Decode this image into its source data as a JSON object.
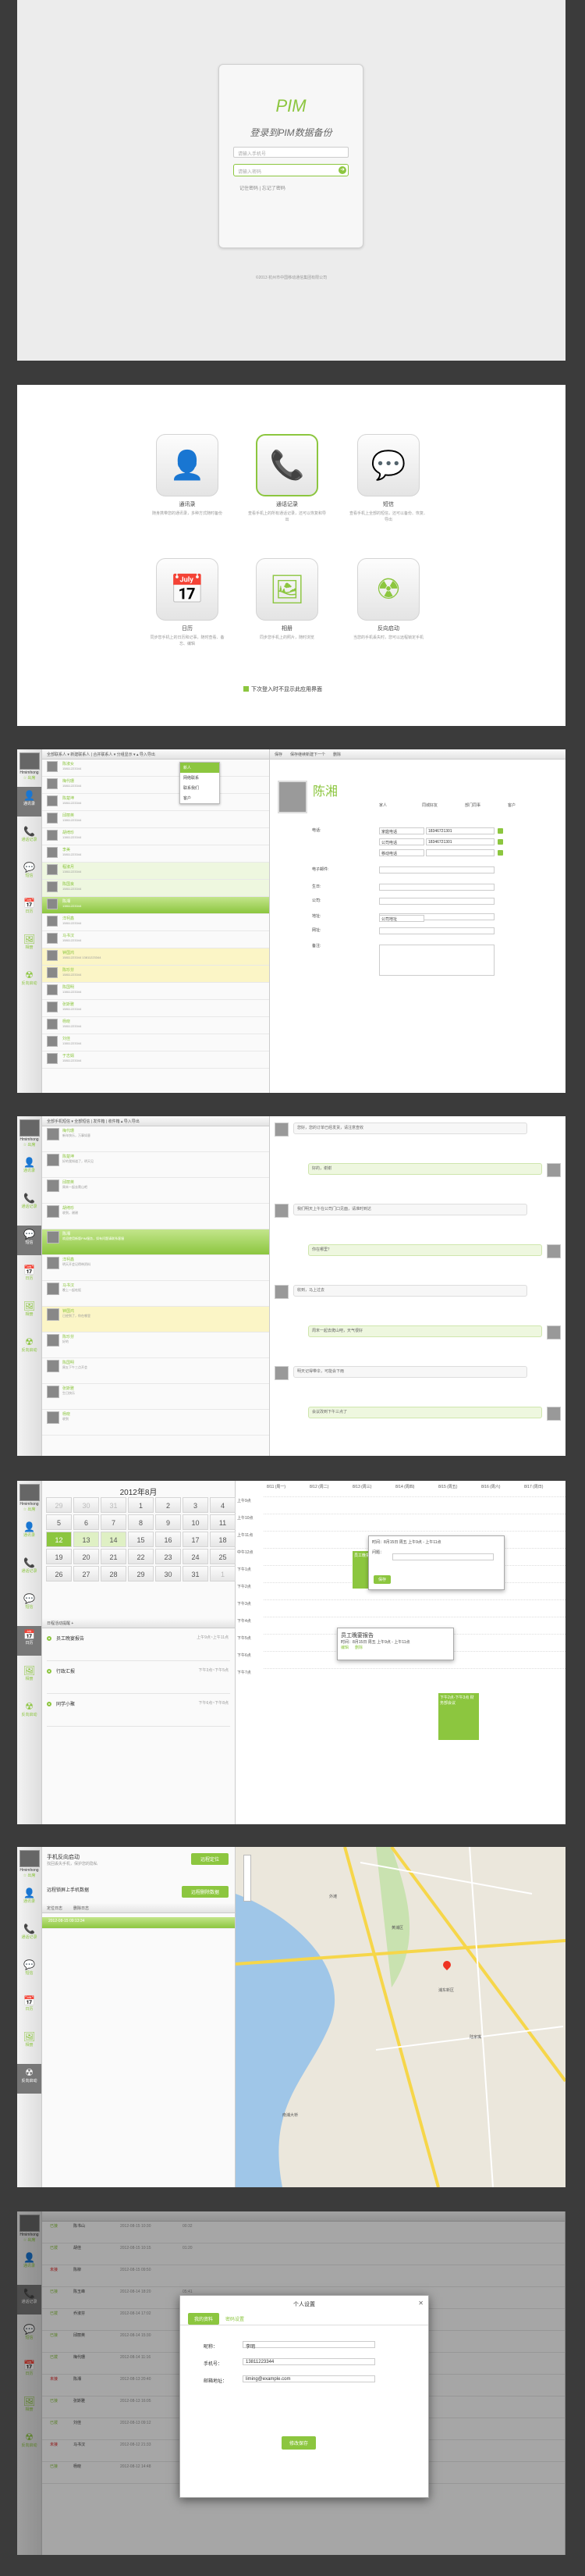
{
  "login": {
    "logo": "PIM",
    "title": "登录到PIM数据备份",
    "phone_placeholder": "请输入手机号",
    "password_placeholder": "请输入密码",
    "go": "➜",
    "remember": "记住密码  |  忘记了密码",
    "copyright": "©2013 杭州市中国移动通信集团有限公司"
  },
  "apps": {
    "items": [
      {
        "name": "通讯录",
        "desc": "随身携带您的通讯录，多种方式随时备份",
        "icon": "👤"
      },
      {
        "name": "通话记录",
        "desc": "查看手机上的所有通话记录，还可以恢复和导出",
        "icon": "📞"
      },
      {
        "name": "短信",
        "desc": "查看手机上全部的短信，还可以备份、恢复、导出",
        "icon": "💬"
      },
      {
        "name": "日历",
        "desc": "同步您手机上的日历和记事，随时查看、备忘、编辑",
        "icon": "📅"
      },
      {
        "name": "相册",
        "desc": "同步您手机上的照片，随时浏览",
        "icon": "🖼"
      },
      {
        "name": "反向启动",
        "desc": "当您的手机丢失时，您可以远程锁定手机",
        "icon": "☢"
      }
    ],
    "note": "下次登入时不显示此应用界面"
  },
  "sidebar": {
    "user": "Hmimhong",
    "sub": "☆ 出席",
    "nav": [
      "通讯录",
      "通话记录",
      "短信",
      "日历",
      "相册",
      "反向启动"
    ]
  },
  "contacts": {
    "toolbar": "全部联系人 ▾   新建联系人 | 合并联系人 ▾   分组显示 ▾   ▴ 导入导出",
    "rows": [
      {
        "name": "陈淑女",
        "num": "15811223344"
      },
      {
        "name": "梅代珊",
        "num": "15811223344"
      },
      {
        "name": "陈楚坤",
        "num": "15811223344"
      },
      {
        "name": "邱丽英",
        "num": "13811223344"
      },
      {
        "name": "胡绮珍",
        "num": "13811223344"
      },
      {
        "name": "李美",
        "num": "15811223344"
      },
      {
        "name": "程淑月",
        "num": "13811223344"
      },
      {
        "name": "陈国良",
        "num": "15811223344"
      },
      {
        "name": "陈湘",
        "num": "13811223344"
      },
      {
        "name": "洋柯鑫",
        "num": "15811223344"
      },
      {
        "name": "马书汉",
        "num": "15811223344"
      },
      {
        "name": "钟国鸿",
        "num": "15811223344  13811223344"
      },
      {
        "name": "陈珍芬",
        "num": "15811223344"
      },
      {
        "name": "陈国明",
        "num": "13811223344"
      },
      {
        "name": "张斯雅",
        "num": "15811223344"
      },
      {
        "name": "杨晓",
        "num": "15811223344"
      },
      {
        "name": "刘佳",
        "num": "13811223344"
      },
      {
        "name": "于志娟",
        "num": "15811223344"
      }
    ],
    "menu": [
      "新人",
      "网络联系",
      "联系我们",
      "客户"
    ],
    "detail_tabs": [
      "保存",
      "保存继续新建下一个",
      "删除"
    ],
    "name": "陈湘",
    "groups": [
      "家人",
      "同城好友",
      "部门同事",
      "客户"
    ],
    "labels": [
      "电话:",
      "电子邮件:",
      "生日:",
      "公司:",
      "地址:",
      "网址:",
      "备注:"
    ],
    "phones": [
      {
        "type": "家庭电话",
        "num": "18346721301"
      },
      {
        "type": "公司电话",
        "num": "18346721301"
      },
      {
        "type": "移动电话",
        "num": ""
      }
    ],
    "addr_type": "公司地址"
  },
  "sms": {
    "toolbar": "全部手机短信 ▾  全部短信 | 发件箱 | 收件箱   ▴ 导入导出",
    "rows": [
      {
        "name": "梅代珊",
        "txt": "新年快乐，万事如意"
      },
      {
        "name": "陈楚坤",
        "txt": "好的我知道了，明天见"
      },
      {
        "name": "邱丽英",
        "txt": "周末一起去爬山吧"
      },
      {
        "name": "胡绮珍",
        "txt": "收到，谢谢"
      },
      {
        "name": "陈湘",
        "txt": "欢迎使用新版PIM服务，如有问题请联系客服"
      },
      {
        "name": "洋柯鑫",
        "txt": "明天开会记得带资料"
      },
      {
        "name": "马书汉",
        "txt": "晚上一起吃饭"
      },
      {
        "name": "钟国鸿",
        "txt": "已经到了，你在哪里"
      },
      {
        "name": "陈珍芬",
        "txt": "好的"
      },
      {
        "name": "陈国明",
        "txt": "周五下午三点开会"
      },
      {
        "name": "张斯雅",
        "txt": "生日快乐"
      },
      {
        "name": "杨晓",
        "txt": "收到"
      }
    ],
    "bubbles": [
      "您好，您的订单已经发货，请注意查收",
      "好的，谢谢",
      "我们明天上午在公司门口见面，请准时到达",
      "你在哪里？",
      "收到，马上过去",
      "周末一起去爬山吧，天气很好",
      "明天记得带伞，可能会下雨",
      "会议改到下午三点了"
    ]
  },
  "calendar": {
    "month": "2012年8月",
    "days": [
      "29",
      "30",
      "31",
      "1",
      "2",
      "3",
      "4",
      "5",
      "6",
      "7",
      "8",
      "9",
      "10",
      "11",
      "12",
      "13",
      "14",
      "15",
      "16",
      "17",
      "18",
      "19",
      "20",
      "21",
      "22",
      "23",
      "24",
      "25",
      "26",
      "27",
      "28",
      "29",
      "30",
      "31",
      "1"
    ],
    "week": [
      "8/11 (周一)",
      "8/12 (周二)",
      "8/13 (周三)",
      "8/14 (周四)",
      "8/15 (周五)",
      "8/16 (周六)",
      "8/17 (周日)"
    ],
    "hours": [
      "上午9点",
      "上午10点",
      "上午11点",
      "中午12点",
      "下午1点",
      "下午2点",
      "下午3点",
      "下午4点",
      "下午5点",
      "下午6点",
      "下午7点"
    ],
    "events": [
      {
        "title": "员工晚宴报告",
        "time": "上午9点~上午11点"
      },
      {
        "title": "行政汇报",
        "time": "下午3点~下午5点"
      },
      {
        "title": "同学小聚",
        "time": "下午6点~下午8点"
      }
    ],
    "agenda_label": "日程活动提醒  +",
    "popup_time": "时间：8月15日 周五 上午9点 - 上午11点",
    "popup_label": "问题：",
    "popup_btn": "保存",
    "popup2": "时间：8月15日 周五 上午9点 - 上午11点",
    "popup2_a": "编辑",
    "popup2_b": "删除",
    "late_evt": "下午2点-下午3点 财务部会议"
  },
  "locate": {
    "title": "手机反向启动",
    "desc": "找回丢失手机，保护您的隐私",
    "btn1": "远程定位",
    "label2": "远程锁屏上手机数据",
    "btn2": "远程删除数据",
    "tabs": [
      "定位日志",
      "删除日志"
    ],
    "time": "2012-08-15 09:13:34",
    "map_labels": [
      "浦东新区",
      "黄浦区",
      "陆家嘴",
      "外滩",
      "南浦大桥"
    ]
  },
  "profile": {
    "title": "个人设置",
    "tabs": [
      "我的资料",
      "密码设置"
    ],
    "labels": [
      "昵称：",
      "手机号：",
      "邮箱地址："
    ],
    "values": [
      "李明",
      "13811223344",
      "liming@example.com"
    ],
    "save": "修改保存",
    "close": "✕",
    "rows": [
      {
        "status": "已接",
        "name": "陈书山",
        "time": "2012-08-15 10:30",
        "dur": "00:32"
      },
      {
        "status": "已拨",
        "name": "胡佳",
        "time": "2012-08-15 10:15",
        "dur": "01:20"
      },
      {
        "status": "未接",
        "name": "陈柳",
        "time": "2012-08-15 09:50",
        "dur": ""
      },
      {
        "status": "已接",
        "name": "陈玉峰",
        "time": "2012-08-14 18:20",
        "dur": "05:41"
      },
      {
        "status": "已拨",
        "name": "乔淑芬",
        "time": "2012-08-14 17:02",
        "dur": "00:45"
      },
      {
        "status": "已接",
        "name": "邱丽英",
        "time": "2012-08-14 15:30",
        "dur": "02:11"
      },
      {
        "status": "已拨",
        "name": "梅代珊",
        "time": "2012-08-14 11:16",
        "dur": "00:28"
      },
      {
        "status": "未接",
        "name": "陈湘",
        "time": "2012-08-13 20:40",
        "dur": ""
      },
      {
        "status": "已接",
        "name": "张斯雅",
        "time": "2012-08-13 16:05",
        "dur": "03:57"
      },
      {
        "status": "已拨",
        "name": "刘佳",
        "time": "2012-08-13 09:12",
        "dur": "00:19"
      },
      {
        "status": "未接",
        "name": "马书汉",
        "time": "2012-08-12 21:33",
        "dur": ""
      },
      {
        "status": "已接",
        "name": "杨晓",
        "time": "2012-08-12 14:48",
        "dur": "01:05"
      }
    ]
  }
}
